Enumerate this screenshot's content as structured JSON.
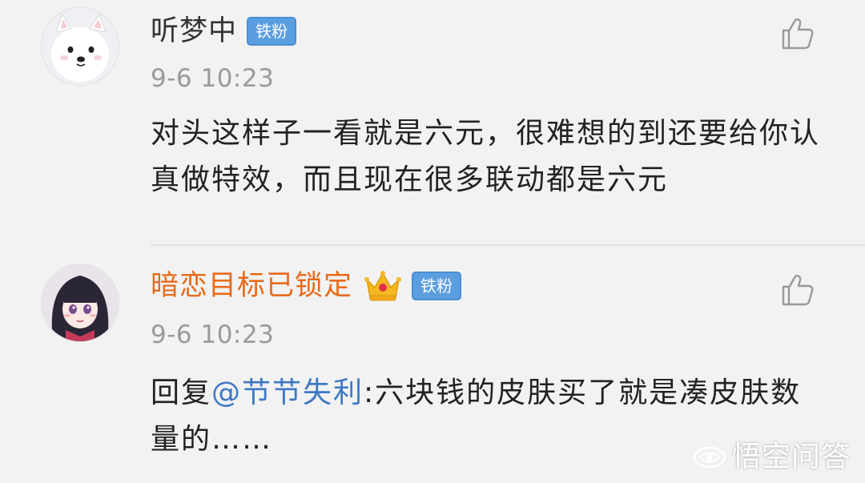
{
  "comments": [
    {
      "username": "听梦中",
      "badge": "铁粉",
      "timestamp": "9-6 10:23",
      "text": "对头这样子一看就是六元，很难想的到还要给你认真做特效，而且现在很多联动都是六元",
      "avatar_icon": "white-dog-avatar",
      "like_icon": "thumbs-up-icon"
    },
    {
      "username": "暗恋目标已锁定",
      "badge": "铁粉",
      "vip_icon": "crown-icon",
      "timestamp": "9-6 10:23",
      "reply_prefix": "回复",
      "mention": "@节节失利",
      "text": ":六块钱的皮肤买了就是凑皮肤数量的……",
      "avatar_icon": "anime-girl-avatar",
      "like_icon": "thumbs-up-icon"
    }
  ],
  "watermark": {
    "text": "悟空问答"
  },
  "colors": {
    "background": "#f2f2f2",
    "vip_name": "#e86a1a",
    "mention": "#3d78c4",
    "badge": "#5a9ee0",
    "timestamp": "#9a9a9a"
  }
}
